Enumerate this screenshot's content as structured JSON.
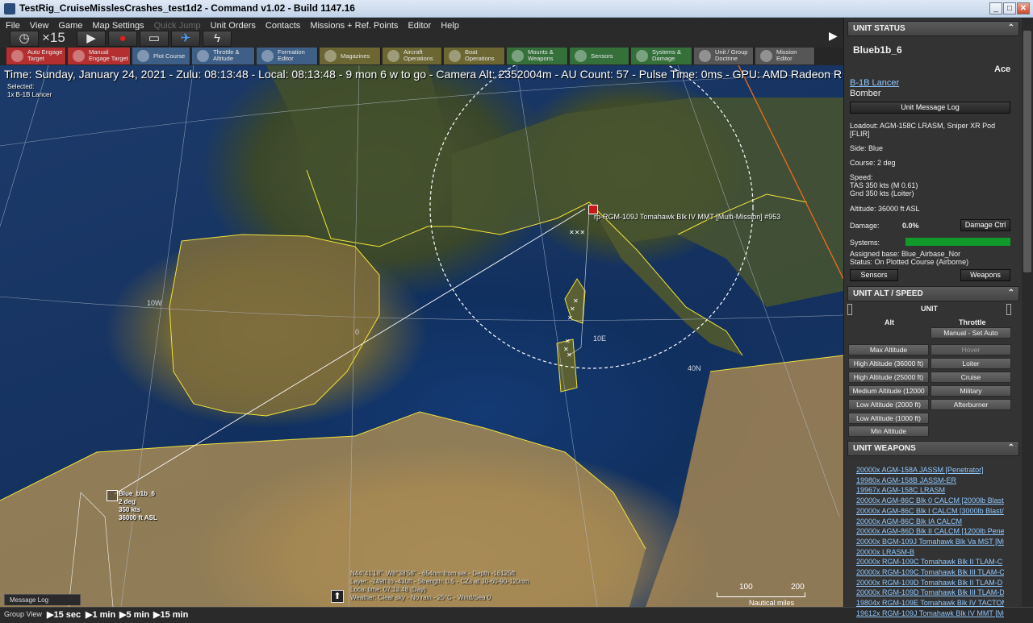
{
  "window": {
    "title": "TestRig_CruiseMisslesCrashes_test1d2 - Command v1.02 - Build 1147.16",
    "min_label": "_",
    "max_label": "□",
    "close_label": "✕"
  },
  "menu": [
    "File",
    "View",
    "Game",
    "Map Settings",
    "Quick Jump",
    "Unit Orders",
    "Contacts",
    "Missions + Ref. Points",
    "Editor",
    "Help"
  ],
  "menu_disabled": "Quick Jump",
  "toolbar": {
    "speed": "×15",
    "clock_icon": "clock-icon",
    "play_icon": "play-icon",
    "record_icon": "record-icon",
    "ship_icon": "ship-icon",
    "plane_icon": "plane-icon",
    "bolt_icon": "bolt-icon"
  },
  "functions": [
    {
      "line1": "Auto Engage",
      "line2": "Target",
      "color": "#b43030"
    },
    {
      "line1": "Manual",
      "line2": "Engage Target",
      "color": "#b43030"
    },
    {
      "line1": "Plot Course",
      "line2": "",
      "color": "#3e5f86"
    },
    {
      "line1": "Throttle &",
      "line2": "Altitude",
      "color": "#3e5f86"
    },
    {
      "line1": "Formation",
      "line2": "Editor",
      "color": "#3e5f86"
    },
    {
      "line1": "Magazines",
      "line2": "",
      "color": "#6b6632"
    },
    {
      "line1": "Aircraft",
      "line2": "Operations",
      "color": "#6b6632"
    },
    {
      "line1": "Boat",
      "line2": "Operations",
      "color": "#6b6632"
    },
    {
      "line1": "Mounts &",
      "line2": "Weapons",
      "color": "#35703b"
    },
    {
      "line1": "Sensors",
      "line2": "",
      "color": "#35703b"
    },
    {
      "line1": "Systems &",
      "line2": "Damage",
      "color": "#35703b"
    },
    {
      "line1": "Unit / Group",
      "line2": "Doctrine",
      "color": "#565656"
    },
    {
      "line1": "Mission",
      "line2": "Editor",
      "color": "#565656"
    }
  ],
  "map": {
    "status_line": "Time: Sunday, January 24, 2021 - Zulu: 08:13:48 - Local: 08:13:48 - 9 mon 6 w to go - Camera Alt: 2352004m - AU Count: 57 - Pulse Time: 0ms - GPU: AMD Radeon R",
    "selected_line1": "Selected:",
    "selected_line2": "1x B-1B Lancer",
    "grid_10w": "10W",
    "grid_0": "0",
    "grid_10e": "10E",
    "grid_40n": "40N",
    "unit_tag": [
      "Blue_b1b_6",
      "2 deg",
      "350 kts",
      "36000 ft ASL"
    ],
    "missile_label": "rp-RGM-109J Tomahawk Blk IV MMT [Multi-Mission] #953",
    "cursor_info": "N44°41'18\"  W8°38'58\" - 654nm from sel - Depth -16125ft\nLayer: -249ft to -430ft - Strength: 0.5 - CZs at 30-60-90-120nm\nLocal time: 07:13:48 (Day)\nWeather: Clear sky - No rain - 25°C - Wind/Sea 0",
    "scale_100": "100",
    "scale_200": "200",
    "scale_unit": "Nautical miles",
    "message_log": "Message Log"
  },
  "bottom": {
    "group_view": "Group View",
    "steps": [
      "15 sec",
      "1 min",
      "5 min",
      "15 min"
    ]
  },
  "unit_status": {
    "header": "UNIT STATUS",
    "name": "Blueb1b_6",
    "proficiency": "Ace",
    "class_link": "B-1B Lancer",
    "type": "Bomber",
    "msg_log_button": "Unit Message Log",
    "loadout_1": "Loadout: AGM-158C LRASM, Sniper XR Pod",
    "loadout_2": "[FLIR]",
    "side": "Side: Blue",
    "course": "Course: 2 deg",
    "speed_label": "Speed:",
    "speed_tas": "TAS 350 kts (M 0.61)",
    "speed_gnd": "Gnd 350 kts (Loiter)",
    "altitude": "Altitude: 36000 ft ASL",
    "damage_label": "Damage:",
    "damage_value": "0.0%",
    "damage_button": "Damage Ctrl",
    "systems_label": "Systems:",
    "systems_health": 1.0,
    "systems_color": "#119a2a",
    "base": "Assigned base: Blue_Airbase_Nor",
    "status": "Status: On Plotted Course (Airborne)",
    "sensors_button": "Sensors",
    "weapons_button": "Weapons"
  },
  "alt_speed": {
    "header": "UNIT ALT / SPEED",
    "unit_label": "UNIT",
    "alt_label": "Alt",
    "throttle_label": "Throttle",
    "manual_button": "Manual - Set Auto",
    "alt_buttons": [
      "Max Altitude",
      "High Altitude (36000 ft)",
      "High Altitude (25000 ft)",
      "Medium Altitude (12000",
      "Low Altitude (2000 ft)",
      "Low Altitude (1000 ft)",
      "Min Altitude"
    ],
    "throttle_buttons": [
      "Hover",
      "Loiter",
      "Cruise",
      "Military",
      "Afterburner"
    ]
  },
  "weapons": {
    "header": "UNIT WEAPONS",
    "items": [
      "20000x AGM-158A JASSM [Penetrator]",
      "19980x AGM-158B JASSM-ER",
      "19967x AGM-158C LRASM",
      "20000x AGM-86C Blk 0 CALCM [2000lb Blast/",
      "20000x AGM-86C Blk I CALCM [3000lb Blast/F",
      "20000x AGM-86C Blk IA CALCM",
      "20000x AGM-86D Blk II CALCM [1200lb Penet",
      "20000x BGM-109J Tomahawk Blk Va MST [Mu",
      "20000x LRASM-B",
      "20000x RGM-109C Tomahawk Blk II TLAM-C",
      "20000x RGM-109C Tomahawk Blk III TLAM-C",
      "20000x RGM-109D Tomahawk Blk II TLAM-D",
      "20000x RGM-109D Tomahawk Blk III TLAM-D",
      "19804x RGM-109E Tomahawk Blk IV TACTOM",
      "19612x RGM-109J Tomahawk Blk IV MMT [Mu"
    ]
  }
}
